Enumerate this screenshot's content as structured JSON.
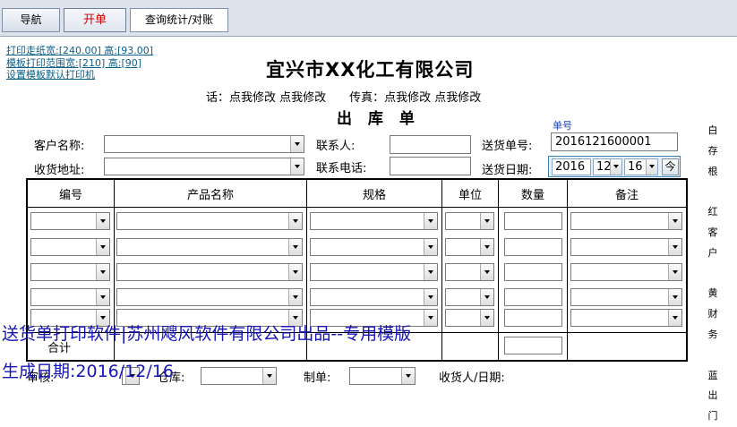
{
  "tabs": [
    {
      "label": "导航"
    },
    {
      "label": "开单"
    },
    {
      "label": "查询统计/对账"
    }
  ],
  "top_links": [
    {
      "label": "打印走纸宽:[240.00] 高:[93.00]"
    },
    {
      "label": "模板打印范围宽:[210] 高:[90]"
    },
    {
      "label": "设置模板默认打印机"
    }
  ],
  "header": {
    "company": "宜兴市XX化工有限公司",
    "contact_line": "话：点我修改 点我修改　　传真：点我修改 点我修改",
    "doc_title": "出 库 单"
  },
  "form": {
    "customer_label": "客户名称:",
    "address_label": "收货地址:",
    "contact_label": "联系人:",
    "phone_label": "联系电话:",
    "order_no_label": "送货单号:",
    "order_no_caption": "单号",
    "order_no_value": "2016121600001",
    "date_label": "送货日期:",
    "date_year": "2016",
    "date_month": "12",
    "date_day": "16",
    "today_button": "今"
  },
  "table": {
    "columns": [
      "编号",
      "产品名称",
      "规格",
      "单位",
      "数量",
      "备注"
    ],
    "total_label": "合计"
  },
  "side_notes": {
    "text": [
      "白",
      "存",
      "根",
      "",
      "红",
      "客",
      "户",
      "",
      "黄",
      "财",
      "务",
      "",
      "蓝",
      "出",
      "门"
    ]
  },
  "watermark": {
    "line1": "送货单打印软件|苏州飕风软件有限公司出品--专用模版",
    "line2": "生成日期:2016/12/16"
  },
  "footer": {
    "audit_label": "审核:",
    "warehouse_label": "仓库:",
    "maker_label": "制单:",
    "receiver_label": "收货人/日期:"
  },
  "colors": {
    "active_tab_text": "#d40000",
    "watermark": "#1515b8",
    "link": "#0b5f8a",
    "order_no_caption": "#1a3fb5"
  }
}
